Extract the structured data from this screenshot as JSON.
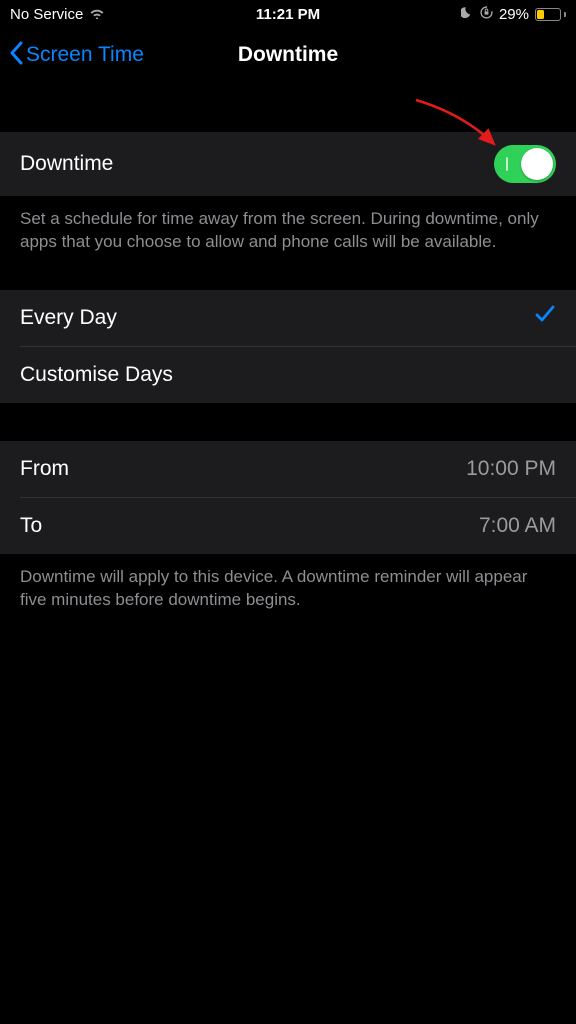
{
  "status": {
    "carrier": "No Service",
    "time": "11:21 PM",
    "battery_pct": "29%"
  },
  "nav": {
    "back_label": "Screen Time",
    "title": "Downtime"
  },
  "downtime": {
    "label": "Downtime",
    "enabled": true,
    "description": "Set a schedule for time away from the screen. During downtime, only apps that you choose to allow and phone calls will be available."
  },
  "schedule_mode": {
    "every_day": "Every Day",
    "customise": "Customise Days",
    "selected": "every_day"
  },
  "time_range": {
    "from_label": "From",
    "from_value": "10:00 PM",
    "to_label": "To",
    "to_value": "7:00 AM"
  },
  "footer": "Downtime will apply to this device. A downtime reminder will appear five minutes before downtime begins."
}
